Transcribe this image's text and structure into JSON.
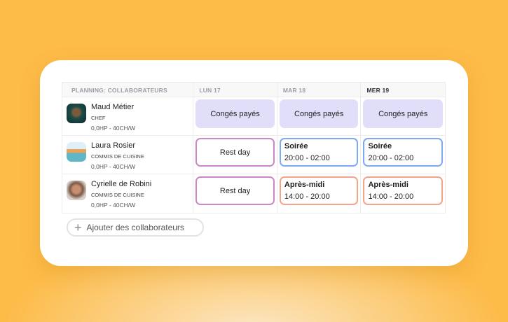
{
  "table": {
    "headers": [
      "PLANNING: COLLABORATEURS",
      "LUN 17",
      "MAR 18",
      "MER 19"
    ],
    "rows": [
      {
        "name": "Maud Métier",
        "role": "CHEF",
        "hours": "0,0HP - 40CH/W",
        "shifts": [
          {
            "type": "leave",
            "label": "Congés payés"
          },
          {
            "type": "leave",
            "label": "Congés payés"
          },
          {
            "type": "leave",
            "label": "Congés payés"
          }
        ]
      },
      {
        "name": "Laura Rosier",
        "role": "COMMIS DE CUISINE",
        "hours": "0,0HP - 40CH/W",
        "shifts": [
          {
            "type": "rest",
            "label": "Rest day"
          },
          {
            "type": "blue",
            "label": "Soirée",
            "time": "20:00 - 02:00"
          },
          {
            "type": "blue",
            "label": "Soirée",
            "time": "20:00 - 02:00"
          }
        ]
      },
      {
        "name": "Cyrielle de Robini",
        "role": "COMMIS DE CUISINE",
        "hours": "0,0HP - 40CH/W",
        "shifts": [
          {
            "type": "rest",
            "label": "Rest day"
          },
          {
            "type": "red",
            "label": "Après-midi",
            "time": "14:00 - 20:00"
          },
          {
            "type": "red",
            "label": "Après-midi",
            "time": "14:00 - 20:00"
          }
        ]
      }
    ]
  },
  "add_button": "Ajouter des collaborateurs",
  "colors": {
    "background": "#fdbb48",
    "leave": "#e1defa",
    "rest": "#cf86c6",
    "evening": "#7fa9f5",
    "afternoon": "#f6a38b"
  }
}
